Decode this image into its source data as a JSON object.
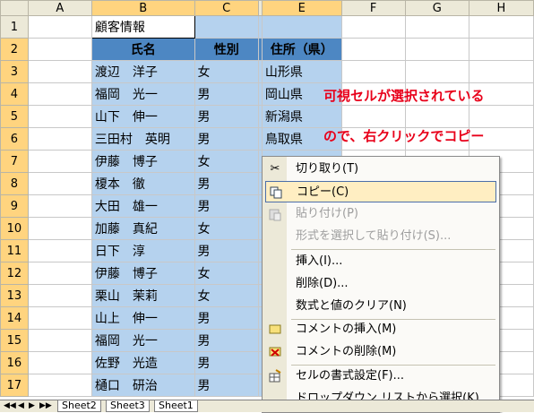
{
  "columns": [
    "",
    "A",
    "B",
    "C",
    "",
    "E",
    "F",
    "G",
    "H"
  ],
  "row_numbers": [
    "1",
    "2",
    "3",
    "4",
    "5",
    "6",
    "7",
    "8",
    "9",
    "10",
    "11",
    "12",
    "13",
    "14",
    "15",
    "16",
    "17"
  ],
  "sheet_title": "顧客情報",
  "table_headers": {
    "name": "氏名",
    "gender": "性別",
    "address": "住所（県）"
  },
  "rows": [
    {
      "name": "渡辺　洋子",
      "gender": "女",
      "pref": "山形県"
    },
    {
      "name": "福岡　光一",
      "gender": "男",
      "pref": "岡山県"
    },
    {
      "name": "山下　伸一",
      "gender": "男",
      "pref": "新潟県"
    },
    {
      "name": "三田村　英明",
      "gender": "男",
      "pref": "鳥取県"
    },
    {
      "name": "伊藤　博子",
      "gender": "女",
      "pref": ""
    },
    {
      "name": "榎本　徹",
      "gender": "男",
      "pref": ""
    },
    {
      "name": "大田　雄一",
      "gender": "男",
      "pref": ""
    },
    {
      "name": "加藤　真紀",
      "gender": "女",
      "pref": ""
    },
    {
      "name": "日下　淳",
      "gender": "男",
      "pref": ""
    },
    {
      "name": "伊藤　博子",
      "gender": "女",
      "pref": ""
    },
    {
      "name": "栗山　茉莉",
      "gender": "女",
      "pref": ""
    },
    {
      "name": "山上　伸一",
      "gender": "男",
      "pref": ""
    },
    {
      "name": "福岡　光一",
      "gender": "男",
      "pref": ""
    },
    {
      "name": "佐野　光造",
      "gender": "男",
      "pref": ""
    },
    {
      "name": "樋口　研治",
      "gender": "男",
      "pref": ""
    }
  ],
  "annotation": {
    "line1": "可視セルが選択されている",
    "line2": "ので、右クリックでコピー"
  },
  "context_menu": {
    "cut": "切り取り(T)",
    "copy": "コピー(C)",
    "paste": "貼り付け(P)",
    "paste_special": "形式を選択して貼り付け(S)...",
    "insert": "挿入(I)...",
    "delete": "削除(D)...",
    "clear": "数式と値のクリア(N)",
    "insert_comment": "コメントの挿入(M)",
    "delete_comment": "コメントの削除(M)",
    "format_cells": "セルの書式設定(F)...",
    "dropdown_pick": "ドロップダウン リストから選択(K)..."
  },
  "sheet_tabs": [
    "Sheet2",
    "Sheet3",
    "Sheet1"
  ],
  "tab_nav": [
    "◀◀",
    "◀",
    "▶",
    "▶▶"
  ],
  "colors": {
    "selection": "#b5d2ee",
    "header_fill": "#4d87c3",
    "annotation": "#e8001a",
    "menu_highlight": "#ffeec2"
  }
}
